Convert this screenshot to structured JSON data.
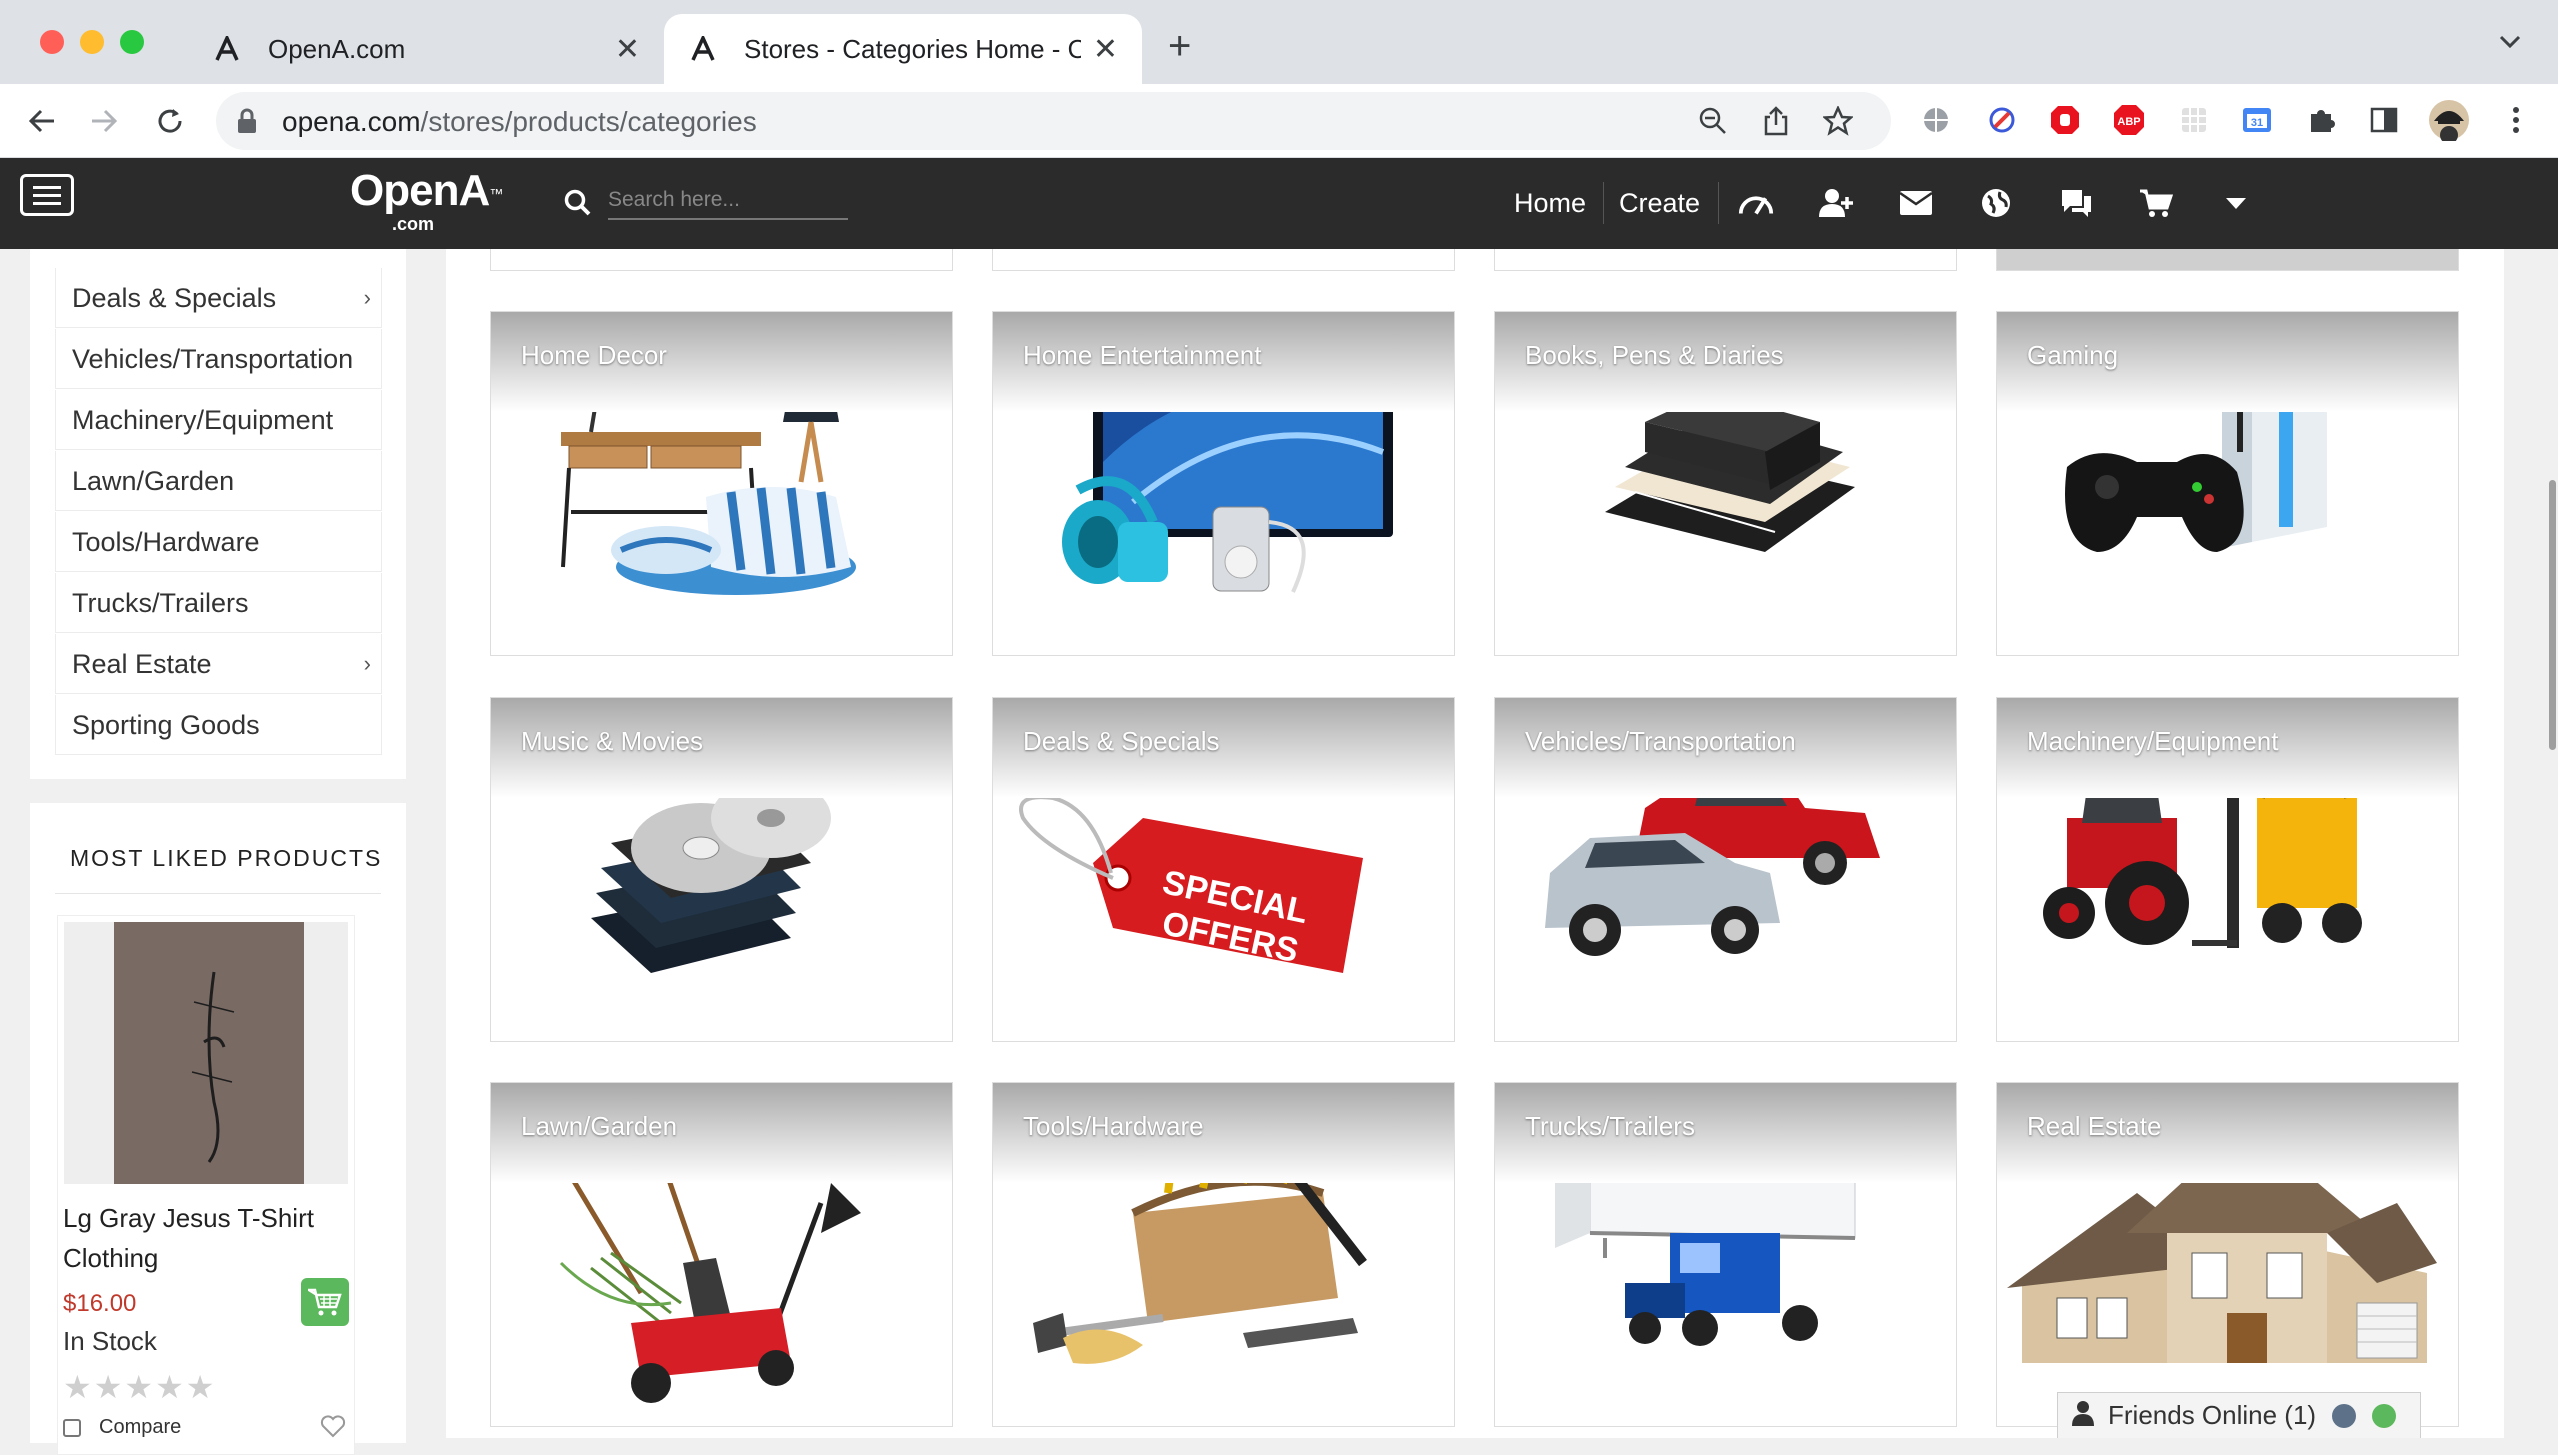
{
  "browser": {
    "tabs": [
      {
        "title": "OpenA.com",
        "active": false
      },
      {
        "title": "Stores - Categories Home - Op",
        "active": true
      }
    ],
    "url_domain": "opena.com",
    "url_path": "/stores/products/categories",
    "traffic_colors": {
      "close": "#ff5f57",
      "minimize": "#febc2e",
      "maximize": "#28c840"
    }
  },
  "site": {
    "logo_main": "OpenA",
    "logo_tm": "™",
    "logo_sub": ".com",
    "search_placeholder": "Search here...",
    "nav": {
      "home": "Home",
      "create": "Create"
    },
    "header_icons": [
      "dashboard-icon",
      "add-friend-icon",
      "mail-icon",
      "globe-icon",
      "chat-icon",
      "cart-icon",
      "caret-down-icon"
    ]
  },
  "sidebar": {
    "categories": [
      {
        "label": "Deals & Specials",
        "has_submenu": true
      },
      {
        "label": "Vehicles/Transportation",
        "has_submenu": false
      },
      {
        "label": "Machinery/Equipment",
        "has_submenu": false
      },
      {
        "label": "Lawn/Garden",
        "has_submenu": false
      },
      {
        "label": "Tools/Hardware",
        "has_submenu": false
      },
      {
        "label": "Trucks/Trailers",
        "has_submenu": false
      },
      {
        "label": "Real Estate",
        "has_submenu": true
      },
      {
        "label": "Sporting Goods",
        "has_submenu": false
      }
    ],
    "chevron": "›",
    "most_liked": {
      "title": "MOST LIKED PRODUCTS",
      "product": {
        "name": "Lg Gray Jesus T-Shirt Clothing",
        "price": "$16.00",
        "stock": "In Stock",
        "rating": 0,
        "stars": "★★★★★",
        "compare_label": "Compare"
      }
    }
  },
  "categories": [
    {
      "label": "Home Decor",
      "art": "home-decor"
    },
    {
      "label": "Home Entertainment",
      "art": "home-entertainment"
    },
    {
      "label": "Books, Pens & Diaries",
      "art": "books"
    },
    {
      "label": "Gaming",
      "art": "gaming"
    },
    {
      "label": "Music & Movies",
      "art": "music"
    },
    {
      "label": "Deals & Specials",
      "art": "deals"
    },
    {
      "label": "Vehicles/Transportation",
      "art": "vehicles"
    },
    {
      "label": "Machinery/Equipment",
      "art": "machinery"
    },
    {
      "label": "Lawn/Garden",
      "art": "lawn"
    },
    {
      "label": "Tools/Hardware",
      "art": "tools"
    },
    {
      "label": "Trucks/Trailers",
      "art": "trucks"
    },
    {
      "label": "Real Estate",
      "art": "realestate"
    }
  ],
  "deals_tag_text": [
    "SPECIAL",
    "OFFERS"
  ],
  "friends": {
    "label": "Friends Online (1)",
    "status_colors": [
      "#5d7289",
      "#5cb85c"
    ]
  },
  "colors": {
    "header_bg": "#2b2b2b",
    "price": "#c0392b",
    "cart_button": "#5cb85c"
  }
}
